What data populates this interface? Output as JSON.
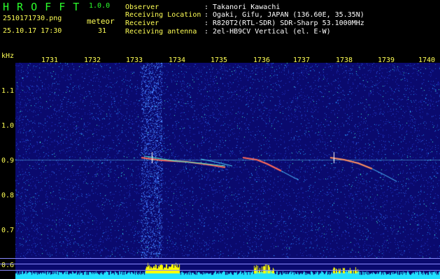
{
  "app": {
    "title": "H R O F F T",
    "version": "1.0.0",
    "filename": "2510171730.png",
    "datetime": "25.10.17 17:30",
    "mode_label": "meteor",
    "count": "31"
  },
  "info": {
    "rows": [
      {
        "label": "Observer",
        "value": ": Takanori Kawachi"
      },
      {
        "label": "Receiving Location",
        "value": ": Ogaki, Gifu, JAPAN (136.60E, 35.35N)"
      },
      {
        "label": "Receiver",
        "value": ": R820T2(RTL-SDR) SDR-Sharp 53.1000MHz"
      },
      {
        "label": "Receiving antenna",
        "value": ": 2el-HB9CV Vertical (el. E-W)"
      }
    ]
  },
  "axes": {
    "y_unit": "kHz",
    "x_ticks": [
      "1731",
      "1732",
      "1733",
      "1734",
      "1735",
      "1736",
      "1737",
      "1738",
      "1739",
      "1740"
    ],
    "y_ticks": [
      "1.1",
      "1.0",
      "0.9",
      "0.8",
      "0.7",
      "0.6"
    ]
  },
  "colors": {
    "background": "#000000",
    "header_green": "#2cff2c",
    "axis_yellow": "#ffff55",
    "spectrogram_bg": "#0a0a6e",
    "carrier": "#5fd0ff",
    "echo": "#ff6a5a",
    "amplitude_yellow": "#ffff00",
    "amplitude_cyan": "#20e0ff"
  }
}
